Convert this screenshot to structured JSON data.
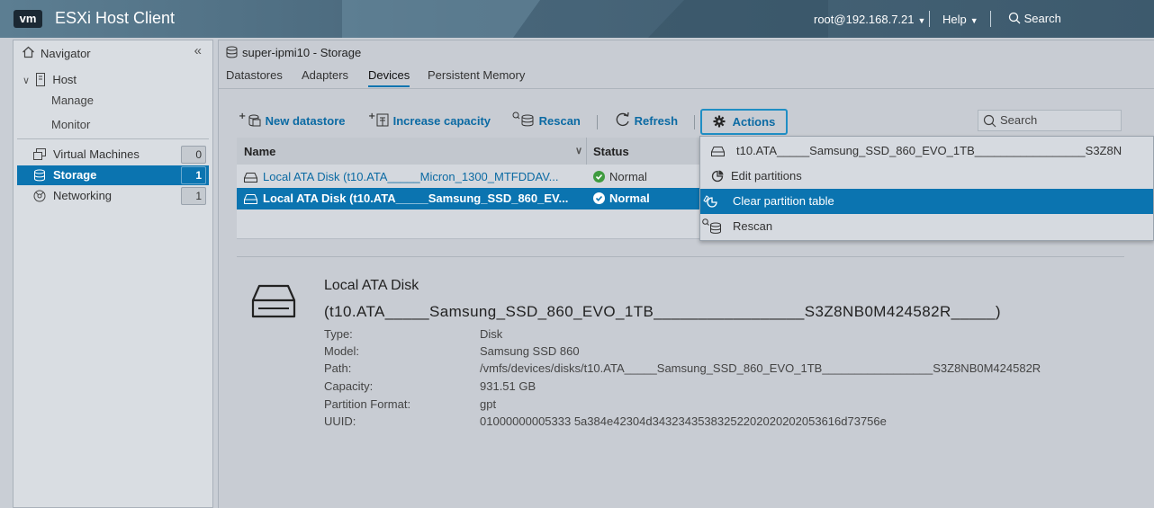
{
  "topbar": {
    "logo": "vm",
    "title": "ESXi Host Client",
    "user": "root@192.168.7.21",
    "help": "Help",
    "search": "Search"
  },
  "navigator": {
    "title": "Navigator",
    "host": "Host",
    "manage": "Manage",
    "monitor": "Monitor",
    "items": [
      {
        "label": "Virtual Machines",
        "count": "0"
      },
      {
        "label": "Storage",
        "count": "1"
      },
      {
        "label": "Networking",
        "count": "1"
      }
    ]
  },
  "main": {
    "breadcrumb": "super-ipmi10 - Storage",
    "tabs": [
      "Datastores",
      "Adapters",
      "Devices",
      "Persistent Memory"
    ],
    "active_tab": "Devices"
  },
  "toolbar": {
    "new_datastore": "New datastore",
    "increase_capacity": "Increase capacity",
    "rescan": "Rescan",
    "refresh": "Refresh",
    "actions": "Actions",
    "search_placeholder": "Search"
  },
  "table": {
    "columns": [
      "Name",
      "Status"
    ],
    "rows": [
      {
        "name": "Local ATA Disk (t10.ATA_____Micron_1300_MTFDDAV...",
        "status": "Normal"
      },
      {
        "name": "Local ATA Disk (t10.ATA_____Samsung_SSD_860_EV...",
        "status": "Normal"
      }
    ]
  },
  "dropdown": {
    "header": "t10.ATA_____Samsung_SSD_860_EVO_1TB_________________S3Z8N",
    "items": [
      "Edit partitions",
      "Clear partition table",
      "Rescan"
    ]
  },
  "details": {
    "title": "Local ATA Disk",
    "id": "(t10.ATA_____Samsung_SSD_860_EVO_1TB_________________S3Z8NB0M424582R_____)",
    "properties": [
      {
        "key": "Type:",
        "value": "Disk"
      },
      {
        "key": "Model:",
        "value": "Samsung SSD 860"
      },
      {
        "key": "Path:",
        "value": "/vmfs/devices/disks/t10.ATA_____Samsung_SSD_860_EVO_1TB_________________S3Z8NB0M424582R"
      },
      {
        "key": "Capacity:",
        "value": "931.51 GB"
      },
      {
        "key": "Partition Format:",
        "value": "gpt"
      },
      {
        "key": "UUID:",
        "value": "01000000005333 5a384e42304d34323435383252202020202053616d73756e"
      }
    ]
  },
  "colors": {
    "accent": "#0b74b0",
    "link": "#0b6aa3",
    "status_ok": "#3f9b3f"
  }
}
